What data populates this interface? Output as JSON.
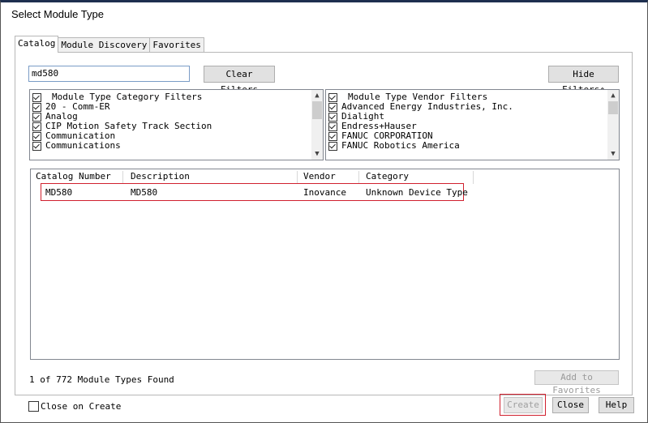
{
  "window": {
    "title": "Select Module Type"
  },
  "tabs": [
    {
      "label": "Catalog",
      "active": true
    },
    {
      "label": "Module Discovery",
      "active": false
    },
    {
      "label": "Favorites",
      "active": false
    }
  ],
  "search": {
    "value": "md580"
  },
  "buttons": {
    "clear_filters": "Clear Filters",
    "hide_filters": "Hide Filters",
    "add_to_favorites": "Add to Favorites",
    "create": "Create",
    "close": "Close",
    "help": "Help"
  },
  "category_filters": {
    "header": "Module Type Category Filters",
    "items": [
      "20 - Comm-ER",
      "Analog",
      "CIP Motion Safety Track Section",
      "Communication",
      "Communications"
    ]
  },
  "vendor_filters": {
    "header": "Module Type Vendor Filters",
    "items": [
      "Advanced Energy Industries, Inc.",
      "Dialight",
      "Endress+Hauser",
      "FANUC CORPORATION",
      "FANUC Robotics America"
    ]
  },
  "results": {
    "columns": [
      "Catalog Number",
      "Description",
      "Vendor",
      "Category"
    ],
    "rows": [
      {
        "catalog_number": "MD580",
        "description": "MD580",
        "vendor": "Inovance",
        "category": "Unknown Device Type"
      }
    ]
  },
  "status": {
    "found_text": "1 of 772 Module Types Found"
  },
  "options": {
    "close_on_create_label": "Close on Create",
    "close_on_create_checked": false
  },
  "colors": {
    "highlight": "#d0202e",
    "title_border": "#1e2f4f"
  }
}
